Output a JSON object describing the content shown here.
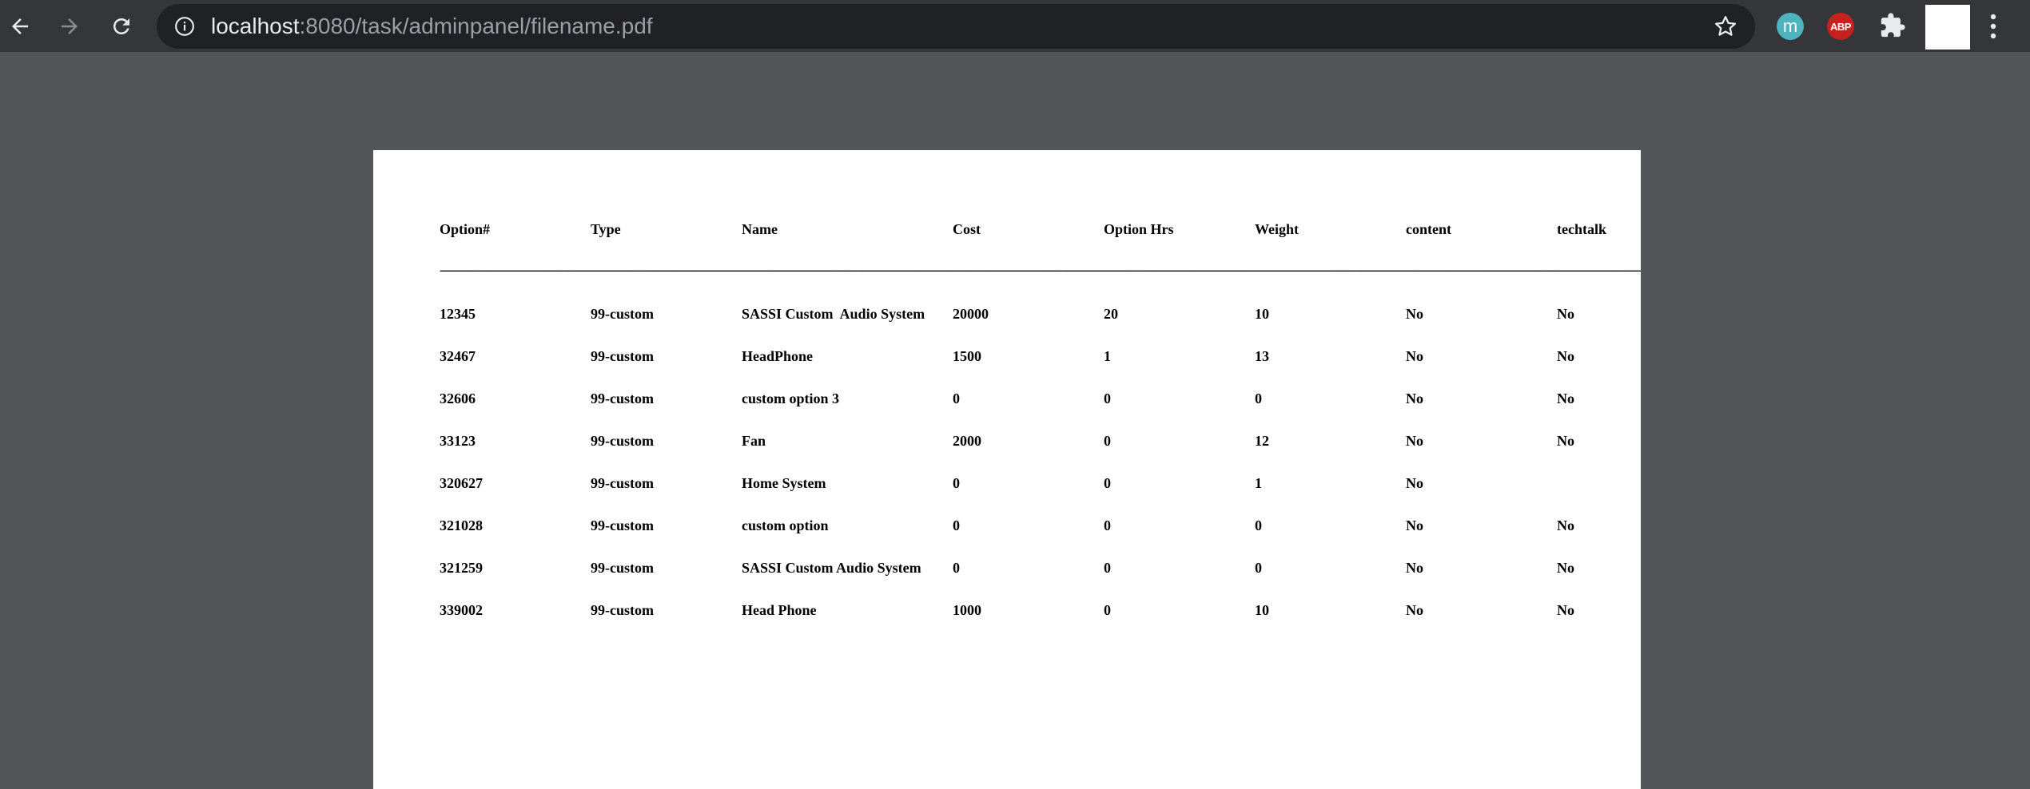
{
  "browser": {
    "url_host": "localhost",
    "url_rest": ":8080/task/adminpanel/filename.pdf",
    "extensions": {
      "m_label": "m",
      "abp_label": "ABP"
    }
  },
  "pdf": {
    "headers": [
      "Option#",
      "Type",
      "Name",
      "Cost",
      "Option Hrs",
      "Weight",
      "content",
      "techtalk"
    ],
    "divider": "----------------------------------------------------------------------------------------------------------------------------------------------------------------------------------------------------------------------------------------------------------------------------------------------------------------------------------------------------------------------------------------------------------------------------------------------------------------------------------------------------------------------------------------------------------------------------------------------------------",
    "rows": [
      [
        "12345",
        "99-custom",
        "SASSI Custom  Audio System",
        "20000",
        "20",
        "10",
        "No",
        "No"
      ],
      [
        "32467",
        "99-custom",
        "HeadPhone",
        "1500",
        "1",
        "13",
        "No",
        "No"
      ],
      [
        "32606",
        "99-custom",
        "custom option 3",
        "0",
        "0",
        "0",
        "No",
        "No"
      ],
      [
        "33123",
        "99-custom",
        "Fan",
        "2000",
        "0",
        "12",
        "No",
        "No"
      ],
      [
        "320627",
        "99-custom",
        "Home System",
        "0",
        "0",
        "1",
        "No",
        ""
      ],
      [
        "321028",
        "99-custom",
        "custom option",
        "0",
        "0",
        "0",
        "No",
        "No"
      ],
      [
        "321259",
        "99-custom",
        "SASSI Custom Audio System",
        "0",
        "0",
        "0",
        "No",
        "No"
      ],
      [
        "339002",
        "99-custom",
        "Head Phone",
        "1000",
        "0",
        "10",
        "No",
        "No"
      ]
    ]
  }
}
